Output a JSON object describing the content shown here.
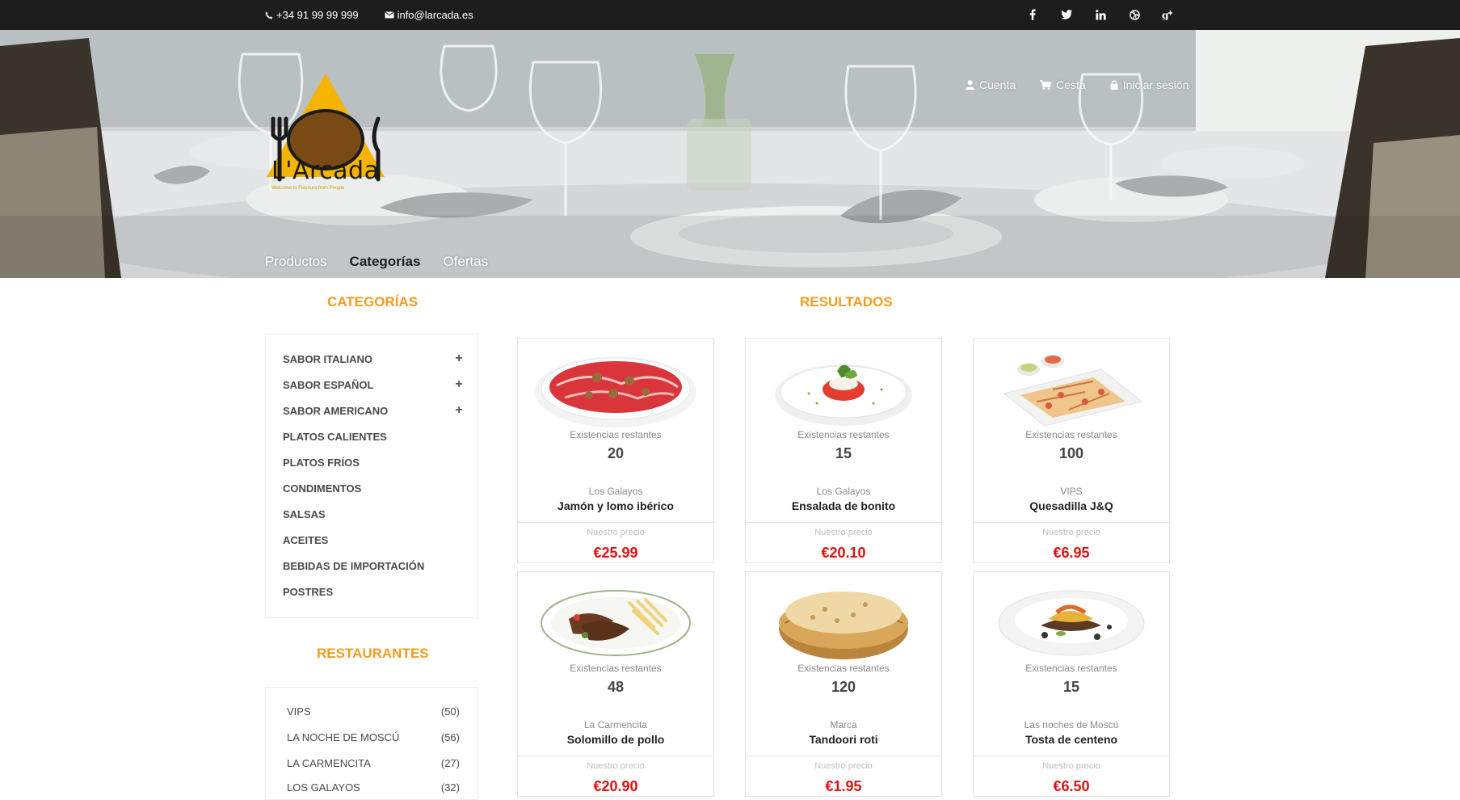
{
  "topbar": {
    "phone": "+34 91 99 99 999",
    "email": "info@larcada.es",
    "social": [
      "facebook-icon",
      "twitter-icon",
      "linkedin-icon",
      "dribbble-icon",
      "google-plus-icon"
    ]
  },
  "header": {
    "logo_text": "L'Arcada",
    "logo_tagline": "Welcome to Flavours from People",
    "links": {
      "account": "Cuenta",
      "cart": "Cesta",
      "login": "Iniciar sesión"
    },
    "nav": {
      "products": "Productos",
      "categories": "Categorías",
      "offers": "Ofertas"
    }
  },
  "categories": {
    "title": "CATEGORÍAS",
    "items": [
      {
        "label": "SABOR ITALIANO",
        "toggle": "+"
      },
      {
        "label": "SABOR ESPAÑOL",
        "toggle": "+"
      },
      {
        "label": "SABOR AMERICANO",
        "toggle": "+"
      },
      {
        "label": "PLATOS CALIENTES"
      },
      {
        "label": "PLATOS FRÍOS"
      },
      {
        "label": "CONDIMENTOS"
      },
      {
        "label": "SALSAS"
      },
      {
        "label": "ACEITES"
      },
      {
        "label": "BEBIDAS DE IMPORTACIÓN"
      },
      {
        "label": "POSTRES"
      }
    ]
  },
  "restaurants": {
    "title": "RESTAURANTES",
    "items": [
      {
        "label": "VIPS",
        "count": "(50)"
      },
      {
        "label": "LA NOCHE DE MOSCÚ",
        "count": "(56)"
      },
      {
        "label": "LA CARMENCITA",
        "count": "(27)"
      },
      {
        "label": "LOS GALAYOS",
        "count": "(32)"
      }
    ]
  },
  "results": {
    "title": "RESULTADOS",
    "stock_label": "Existencias restantes",
    "price_label": "Nuestro precio",
    "products": [
      {
        "stock": "20",
        "brand": "Los Galayos",
        "name": "Jamón y lomo ibérico",
        "price": "€25.99"
      },
      {
        "stock": "15",
        "brand": "Los Galayos",
        "name": "Ensalada de bonito",
        "price": "€20.10"
      },
      {
        "stock": "100",
        "brand": "VIPS",
        "name": "Quesadilla J&Q",
        "price": "€6.95"
      },
      {
        "stock": "48",
        "brand": "La Carmencita",
        "name": "Solomillo de pollo",
        "price": "€20.90"
      },
      {
        "stock": "120",
        "brand": "Marca",
        "name": "Tandoori roti",
        "price": "€1.95"
      },
      {
        "stock": "15",
        "brand": "Las noches de Moscú",
        "name": "Tosta de centeno",
        "price": "€6.50"
      }
    ]
  },
  "colors": {
    "accent": "#f39c1e",
    "price": "#e50f0f",
    "topbar": "#1d1d1d"
  }
}
